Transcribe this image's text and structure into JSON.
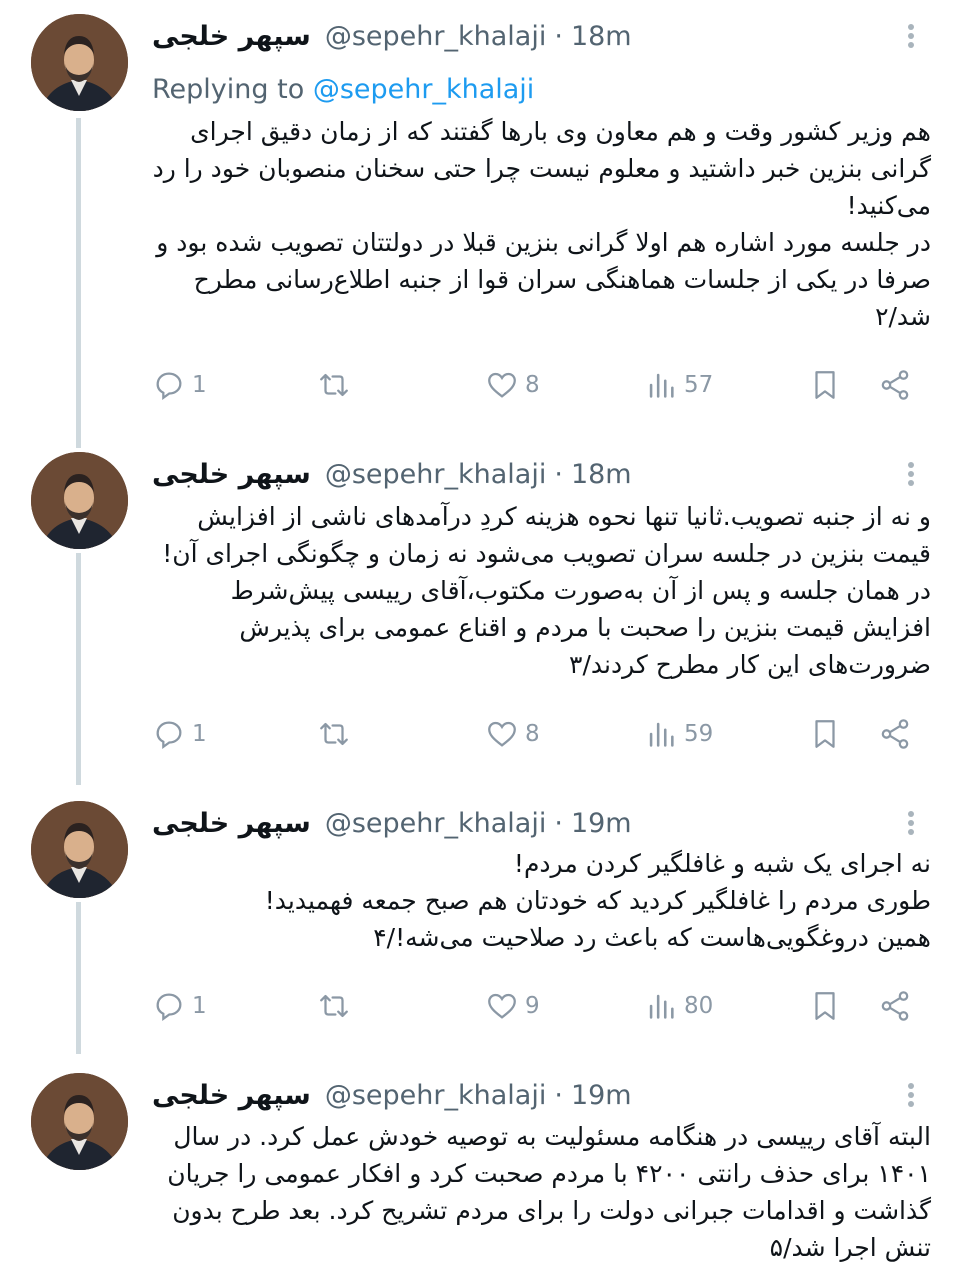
{
  "colors": {
    "accent": "#1d9bf0",
    "muted": "#536471",
    "thread_line": "#cfd9de"
  },
  "tweets": [
    {
      "name": "سپهر خلجی",
      "handle": "@sepehr_khalaji",
      "dot": "·",
      "time": "18m",
      "replying_prefix": "Replying to",
      "replying_handle": "@sepehr_khalaji",
      "text": "هم وزیر کشور وقت و هم معاون وی بارها گفتند که از زمان دقیق اجرای گرانی بنزین خبر داشتید و معلوم نیست چرا حتی سخنان منصوبان خود را رد می‌کنید!\nدر جلسه مورد اشاره هم اولا گرانی بنزین قبلا در دولتتان تصویب شده بود و صرفا در یکی از جلسات هماهنگی سران قوا از جنبه اطلاع‌رسانی مطرح شد/۲",
      "stats": {
        "replies": "1",
        "likes": "8",
        "views": "57"
      }
    },
    {
      "name": "سپهر خلجی",
      "handle": "@sepehr_khalaji",
      "dot": "·",
      "time": "18m",
      "text": "و نه از جنبه تصویب.ثانیا تنها نحوه هزینه کردِ درآمدهای ناشی از افزایش قیمت بنزین در جلسه سران تصویب می‌شود نه زمان و چگونگی اجرای آن!\nدر همان جلسه و پس از آن به‌صورت مکتوب،آقای رییسی پیش‌شرط افزایش قیمت بنزین را صحبت با مردم و اقناع عمومی برای پذیرش ضرورت‌های این کار مطرح کردند/۳",
      "stats": {
        "replies": "1",
        "likes": "8",
        "views": "59"
      }
    },
    {
      "name": "سپهر خلجی",
      "handle": "@sepehr_khalaji",
      "dot": "·",
      "time": "19m",
      "text": "نه اجرای یک شبه و غافلگیر کردن مردم!\nطوری مردم را غافلگیر کردید که خودتان هم صبح جمعه فهمیدید!\nهمین دروغگویی‌هاست که باعث رد صلاحیت می‌شه!/۴",
      "stats": {
        "replies": "1",
        "likes": "9",
        "views": "80"
      }
    },
    {
      "name": "سپهر خلجی",
      "handle": "@sepehr_khalaji",
      "dot": "·",
      "time": "19m",
      "text": "البته آقای رییسی در هنگامه مسئولیت به توصیه خودش عمل کرد. در سال ۱۴۰۱ برای حذف رانتی ۴۲۰۰ با مردم صحبت کرد و افکار عمومی را جریان گذاشت و اقدامات جبرانی دولت را برای مردم تشریح کرد. بعد طرح بدون تنش اجرا شد/۵"
    }
  ]
}
